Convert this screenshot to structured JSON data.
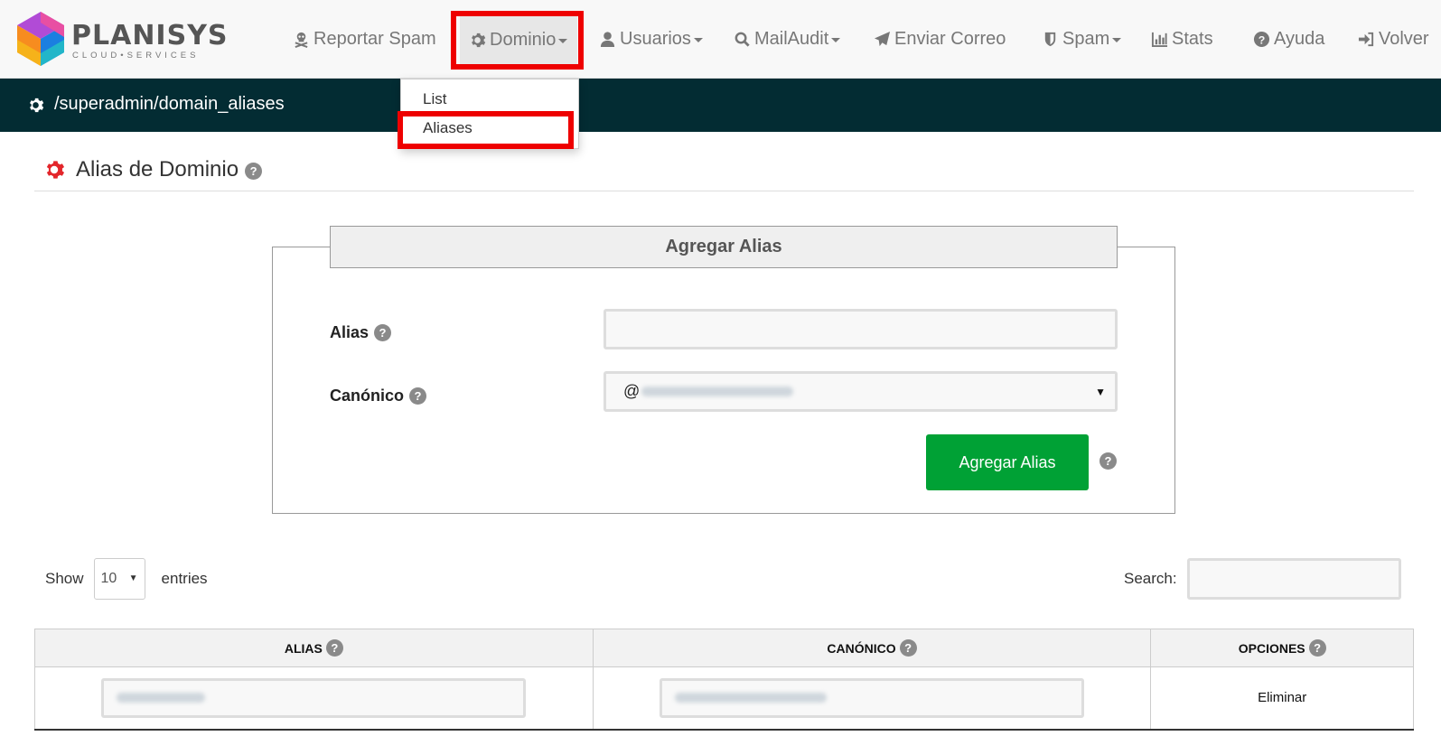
{
  "logo": {
    "name": "PLANISYS",
    "tagline": "CLOUD•SERVICES"
  },
  "nav": {
    "reportar_spam": "Reportar Spam",
    "dominio": "Dominio",
    "usuarios": "Usuarios",
    "mailaudit": "MailAudit",
    "enviar_correo": "Enviar Correo",
    "spam": "Spam",
    "stats": "Stats",
    "ayuda": "Ayuda",
    "volver": "Volver"
  },
  "dropdown": {
    "items": [
      "List",
      "Aliases"
    ]
  },
  "path": "/superadmin/domain_aliases",
  "page": {
    "title": "Alias de Dominio",
    "help": "?"
  },
  "form": {
    "legend": "Agregar Alias",
    "alias_label": "Alias",
    "alias_value": "",
    "canonico_label": "Canónico",
    "canonico_prefix": "@",
    "submit": "Agregar Alias",
    "help": "?"
  },
  "table_controls": {
    "show_label": "Show",
    "page_length": "10",
    "entries_label": "entries",
    "search_label": "Search:",
    "search_value": ""
  },
  "table": {
    "headers": [
      "ALIAS",
      "CANÓNICO",
      "OPCIONES"
    ],
    "rows": [
      {
        "alias": "",
        "canonico": "",
        "opciones": "Eliminar"
      }
    ]
  },
  "colors": {
    "nav_bg": "#f8f8f8",
    "path_bar": "#032c33",
    "accent_red": "#e3262b",
    "highlight": "#ee0000",
    "button_green": "#00a135"
  }
}
